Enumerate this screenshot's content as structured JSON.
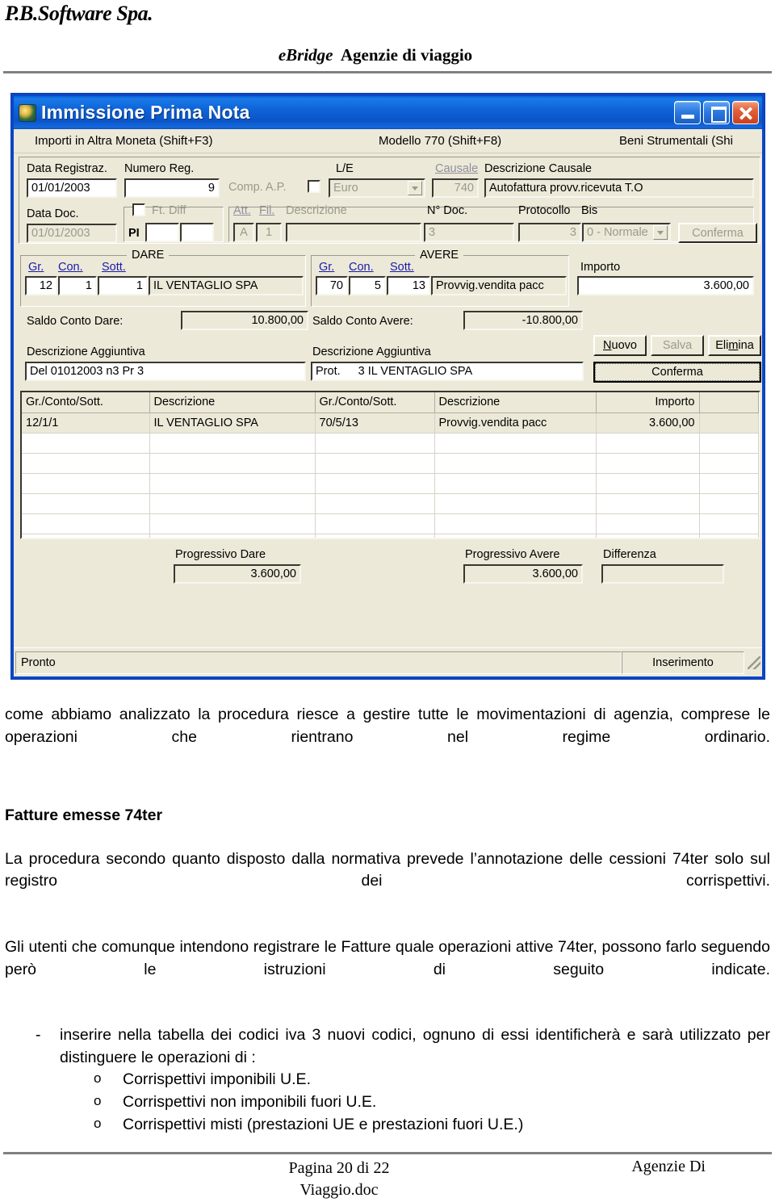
{
  "header": {
    "company": "P.B.Software Spa.",
    "title_italic": "eBridge",
    "title_rest": "Agenzie di viaggio"
  },
  "window": {
    "title": "Immissione Prima Nota",
    "icon": "app-globe-icon",
    "buttons": {
      "minimize": "_",
      "maximize": "□",
      "close": "✕"
    },
    "menu": [
      "Importi in Altra Moneta (Shift+F3)",
      "Modello 770 (Shift+F8)",
      "Beni Strumentali (Shi"
    ],
    "form": {
      "data_registraz_label": "Data Registraz.",
      "data_registraz_value": "01/01/2003",
      "numero_reg_label": "Numero Reg.",
      "numero_reg_value": "9",
      "comp_ap_label": "Comp. A.P.",
      "le_label": "L/E",
      "le_value": "Euro",
      "causale_label": "Causale",
      "causale_value": "740",
      "descrizione_causale_label": "Descrizione Causale",
      "descrizione_causale_value": "Autofattura provv.ricevuta T.O",
      "data_doc_label": "Data Doc.",
      "data_doc_value": "01/01/2003",
      "ft_diff_label": "Ft. Diff",
      "pi_label": "PI",
      "pi_value_1": "",
      "pi_value_2": "",
      "att_label": "Att.",
      "att_value": "A",
      "fil_label": "Fil.",
      "fil_value": "1",
      "descrizione_label": "Descrizione",
      "descrizione_value": "",
      "n_doc_label": "N° Doc.",
      "n_doc_value": "3",
      "protocollo_label": "Protocollo",
      "protocollo_value": "3",
      "bis_label": "Bis",
      "bis_value": "0 - Normale",
      "conferma_top_label": "Conferma"
    },
    "dare": {
      "legend": "DARE",
      "gr_label": "Gr.",
      "con_label": "Con.",
      "sott_label": "Sott.",
      "gr_value": "12",
      "con_value": "1",
      "sott_value": "1",
      "descr_value": "IL VENTAGLIO SPA"
    },
    "avere": {
      "legend": "AVERE",
      "gr_label": "Gr.",
      "con_label": "Con.",
      "sott_label": "Sott.",
      "gr_value": "70",
      "con_value": "5",
      "sott_value": "13",
      "descr_value": "Provvig.vendita pacc",
      "importo_label": "Importo",
      "importo_value": "3.600,00"
    },
    "saldi": {
      "saldo_dare_label": "Saldo Conto Dare:",
      "saldo_dare_value": "10.800,00",
      "saldo_avere_label": "Saldo Conto Avere:",
      "saldo_avere_value": "-10.800,00"
    },
    "descr_agg": {
      "label_left": "Descrizione Aggiuntiva",
      "value_left": "Del 01012003 n3 Pr   3",
      "label_right": "Descrizione Aggiuntiva",
      "value_right_prefix": "Prot.",
      "value_right": "3 IL VENTAGLIO SPA"
    },
    "actions": {
      "nuovo": "Nuovo",
      "salva": "Salva",
      "elimina": "Elimina",
      "conferma": "Conferma"
    },
    "grid": {
      "columns": [
        "Gr./Conto/Sott.",
        "Descrizione",
        "Gr./Conto/Sott.",
        "Descrizione",
        "Importo",
        ""
      ],
      "rows": [
        [
          "12/1/1",
          "IL VENTAGLIO SPA",
          "70/5/13",
          "Provvig.vendita pacc",
          "3.600,00",
          ""
        ]
      ],
      "empty_rows": 6
    },
    "totals": {
      "progressivo_dare_label": "Progressivo Dare",
      "progressivo_dare_value": "3.600,00",
      "progressivo_avere_label": "Progressivo Avere",
      "progressivo_avere_value": "3.600,00",
      "differenza_label": "Differenza",
      "differenza_value": ""
    },
    "status": {
      "left": "Pronto",
      "right": "Inserimento"
    }
  },
  "body": {
    "p1": "come abbiamo analizzato la procedura riesce a gestire tutte le movimentazioni di agenzia, comprese le operazioni che rientrano nel regime ordinario.",
    "h1": "Fatture emesse 74ter",
    "p2": "La procedura secondo quanto disposto dalla normativa prevede l’annotazione delle cessioni 74ter solo sul registro dei corrispettivi.",
    "p3": "Gli utenti che comunque intendono registrare le Fatture quale operazioni attive 74ter, possono farlo seguendo però le istruzioni di seguito indicate.",
    "bullet_marker": "-",
    "bullet_text": "inserire nella tabella dei codici iva 3 nuovi codici, ognuno di essi identificherà e sarà utilizzato per distinguere le operazioni di :",
    "sub_marker": "o",
    "sub_items": [
      "Corrispettivi imponibili U.E.",
      "Corrispettivi non imponibili fuori U.E.",
      "Corrispettivi misti (prestazioni  UE e prestazioni fuori U.E.)"
    ]
  },
  "footer": {
    "page": "Pagina 20 di 22",
    "file": "Viaggio.doc",
    "right": "Agenzie Di"
  }
}
